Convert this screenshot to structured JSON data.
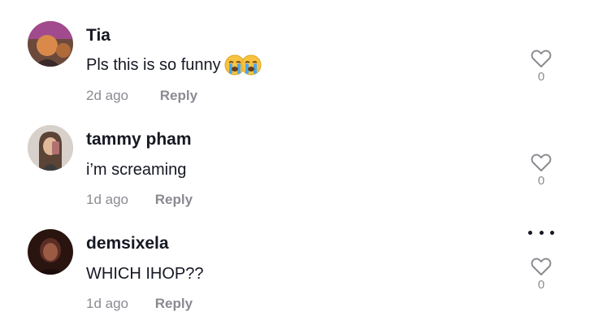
{
  "comments": [
    {
      "username": "Tia",
      "text": "Pls this is so funny",
      "emojis": [
        "loudly-crying-face",
        "loudly-crying-face"
      ],
      "time": "2d ago",
      "reply_label": "Reply",
      "likes": "0",
      "colors": {
        "avatar_bg": "#6b4a3c",
        "avatar_accent": "#d98a4a"
      }
    },
    {
      "username": "tammy pham",
      "text": "i’m screaming",
      "emojis": [],
      "time": "1d ago",
      "reply_label": "Reply",
      "likes": "0",
      "colors": {
        "avatar_bg": "#c9c2bd",
        "avatar_accent": "#5b4336"
      }
    },
    {
      "username": "demsixela",
      "text": "WHICH IHOP??",
      "emojis": [],
      "time": "1d ago",
      "reply_label": "Reply",
      "likes": "0",
      "colors": {
        "avatar_bg": "#2a1410",
        "avatar_accent": "#9a5a44"
      }
    }
  ],
  "icons": {
    "like": "heart-outline-icon",
    "more": "more-horizontal-icon"
  },
  "colors": {
    "text_primary": "#161823",
    "text_secondary": "#8a8b91",
    "background": "#ffffff"
  }
}
